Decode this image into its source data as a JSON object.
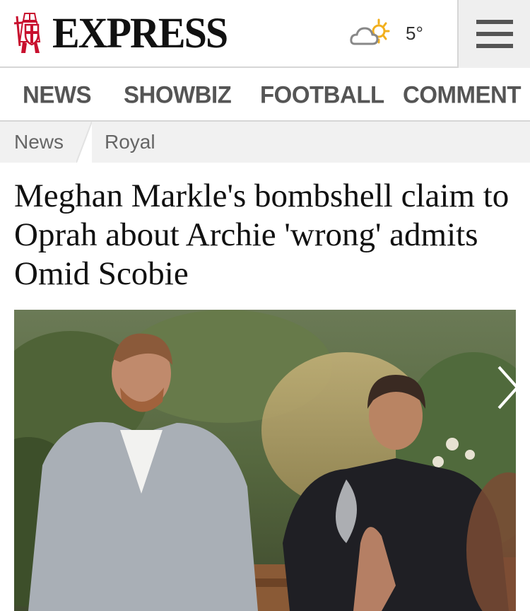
{
  "header": {
    "logo_text": "EXPRESS",
    "logo_icon": "crusader-knight-icon",
    "weather_icon": "partly-sunny-icon",
    "temperature": "5°",
    "menu_icon": "hamburger-menu-icon"
  },
  "nav": {
    "items": [
      {
        "label": "NEWS"
      },
      {
        "label": "SHOWBIZ"
      },
      {
        "label": "FOOTBALL"
      },
      {
        "label": "COMMENT"
      }
    ]
  },
  "breadcrumb": {
    "items": [
      {
        "label": "News"
      },
      {
        "label": "Royal"
      }
    ]
  },
  "article": {
    "headline": "Meghan Markle's bombshell claim to Oprah about Archie 'wrong' admits Omid Scobie",
    "next_icon": "chevron-right-icon"
  },
  "colors": {
    "logo_red": "#c8102e",
    "nav_text": "#555555",
    "breadcrumb_bg": "#f1f1f1",
    "headline_text": "#111111"
  }
}
